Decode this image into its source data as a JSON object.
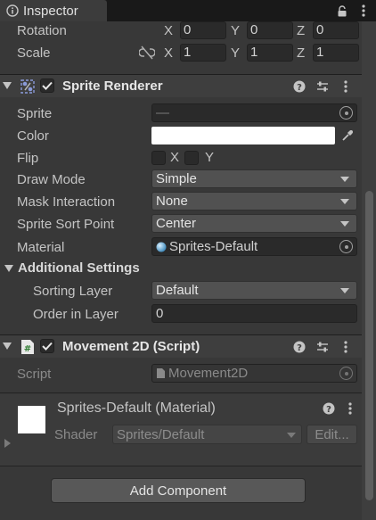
{
  "tab": {
    "title": "Inspector",
    "icon": "info-icon",
    "lock_icon": "lock-icon",
    "menu_icon": "kebab-menu-icon"
  },
  "transform": {
    "rotation_label": "Rotation",
    "rotation": {
      "x": "0",
      "y": "0",
      "z": "0"
    },
    "scale_label": "Scale",
    "scale": {
      "x": "1",
      "y": "1",
      "z": "1"
    },
    "scale_link_icon": "unlinked-icon",
    "axis_x": "X",
    "axis_y": "Y",
    "axis_z": "Z"
  },
  "sprite_renderer": {
    "title": "Sprite Renderer",
    "enabled": true,
    "sprite_label": "Sprite",
    "sprite_value": "—",
    "color_label": "Color",
    "color_value": "#ffffff",
    "flip_label": "Flip",
    "flip_x": "X",
    "flip_y": "Y",
    "draw_mode_label": "Draw Mode",
    "draw_mode_value": "Simple",
    "mask_label": "Mask Interaction",
    "mask_value": "None",
    "sort_point_label": "Sprite Sort Point",
    "sort_point_value": "Center",
    "material_label": "Material",
    "material_value": "Sprites-Default",
    "additional_label": "Additional Settings",
    "sorting_layer_label": "Sorting Layer",
    "sorting_layer_value": "Default",
    "order_label": "Order in Layer",
    "order_value": "0"
  },
  "movement": {
    "title": "Movement 2D (Script)",
    "enabled": true,
    "script_label": "Script",
    "script_value": "Movement2D"
  },
  "material_block": {
    "name": "Sprites-Default (Material)",
    "shader_label": "Shader",
    "shader_value": "Sprites/Default",
    "edit_label": "Edit..."
  },
  "add_component_label": "Add Component",
  "colors": {
    "background": "#383838",
    "header": "#3e3e3e",
    "tab_bar": "#191919"
  }
}
